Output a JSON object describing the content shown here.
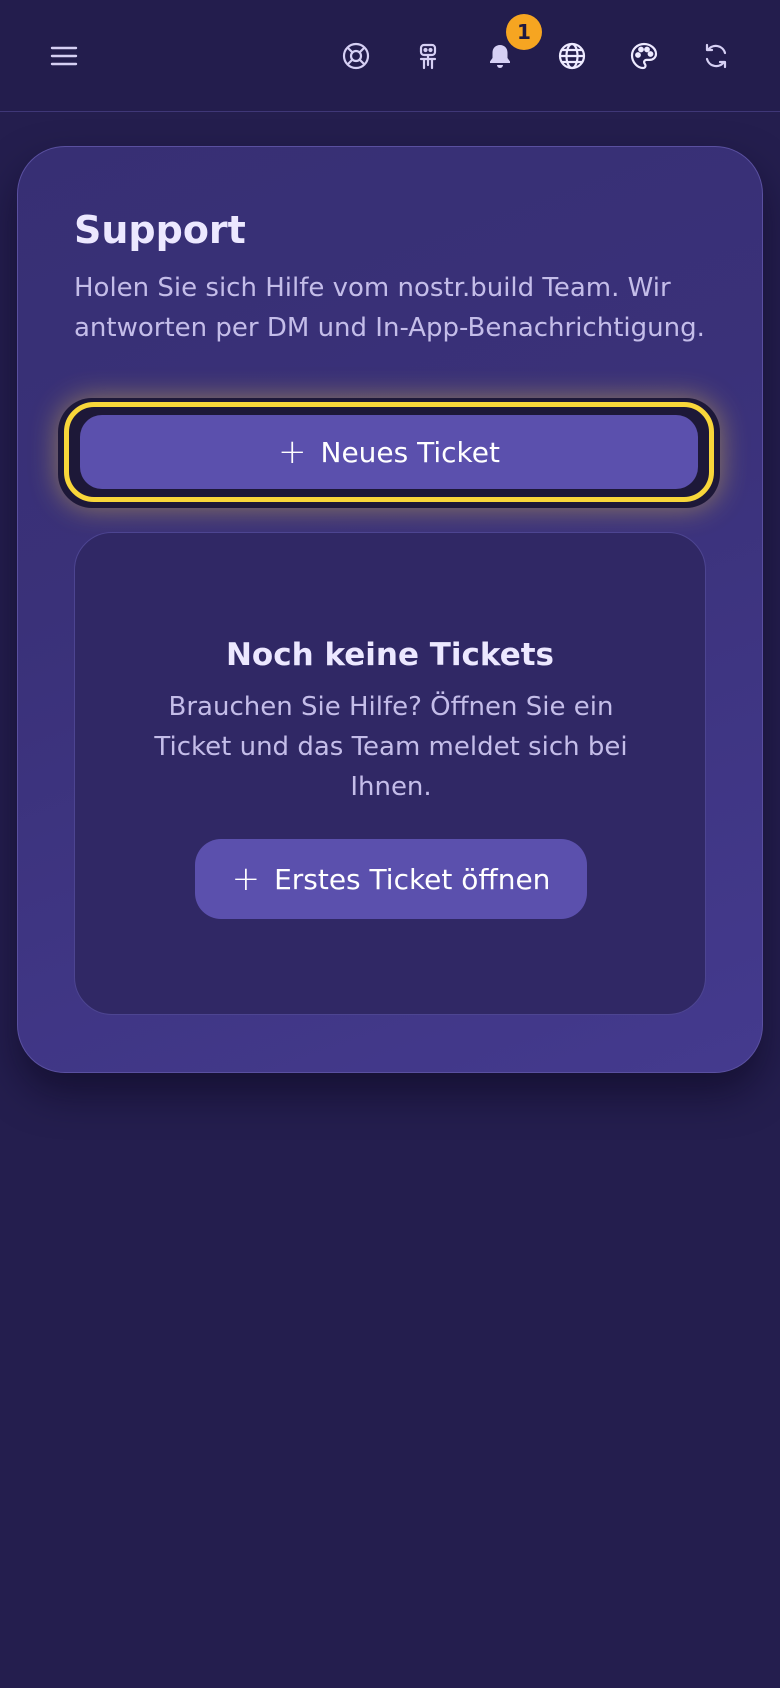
{
  "topbar": {
    "icons": [
      "menu-icon",
      "lifebuoy-icon",
      "robot-icon",
      "bell-icon",
      "globe-icon",
      "palette-icon",
      "refresh-icon"
    ],
    "notification_count": "1"
  },
  "support": {
    "title": "Support",
    "description": "Holen Sie sich Hilfe vom nostr.build Team. Wir antworten per DM und In-App-Benachrichtigung.",
    "new_ticket_label": "Neues Ticket",
    "plus_glyph": "+"
  },
  "empty_state": {
    "title": "Noch keine Tickets",
    "text": "Brauchen Sie Hilfe? Öffnen Sie ein Ticket und das Team meldet sich bei Ihnen.",
    "button_label": "Erstes Ticket öffnen"
  },
  "colors": {
    "background": "#241e4e",
    "card": "#3a3179",
    "accent_button": "#5b50ad",
    "focus_ring": "#f8d63a",
    "badge": "#f6a521",
    "text_primary": "#ece8ff",
    "text_secondary": "#c4bde9"
  }
}
